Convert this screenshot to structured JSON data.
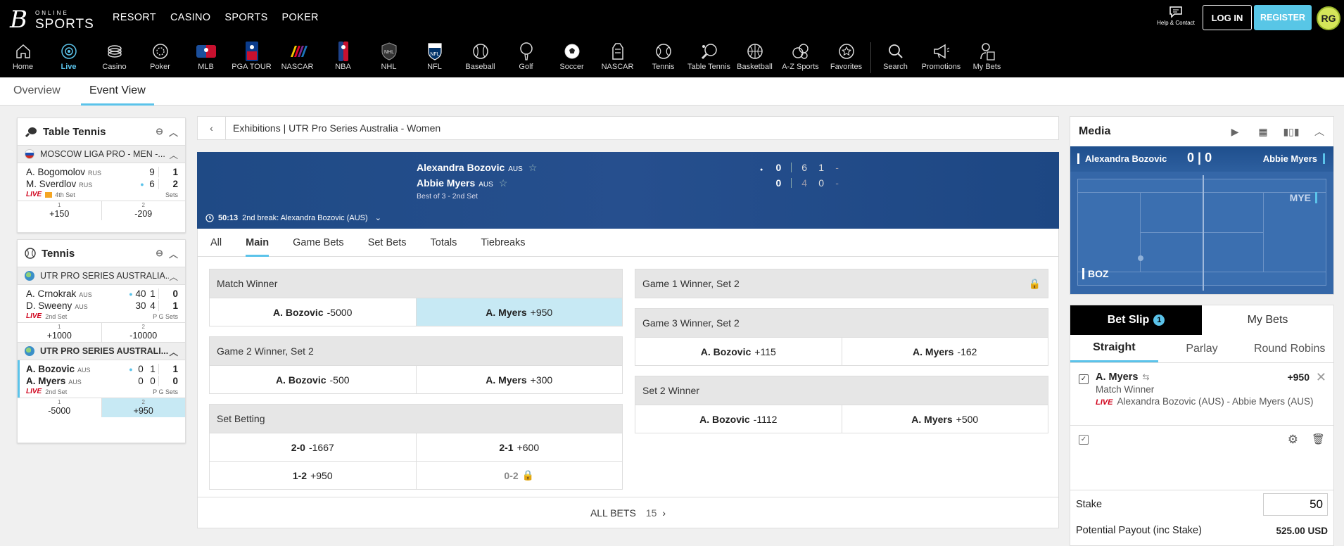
{
  "brand": {
    "online": "ONLINE",
    "sports": "SPORTS"
  },
  "topnav": [
    "RESORT",
    "CASINO",
    "SPORTS",
    "POKER"
  ],
  "header": {
    "help": "Help & Contact",
    "login": "LOG IN",
    "register": "REGISTER",
    "avatar": "RG"
  },
  "iconnav": [
    {
      "label": "Home",
      "icon": "home-icon"
    },
    {
      "label": "Live",
      "icon": "live-icon",
      "active": true
    },
    {
      "label": "Casino",
      "icon": "casino-icon"
    },
    {
      "label": "Poker",
      "icon": "poker-icon"
    },
    {
      "label": "MLB",
      "icon": "mlb-icon"
    },
    {
      "label": "PGA TOUR",
      "icon": "pga-tour-icon"
    },
    {
      "label": "NASCAR",
      "icon": "nascar-stripes-icon"
    },
    {
      "label": "NBA",
      "icon": "nba-icon"
    },
    {
      "label": "NHL",
      "icon": "nhl-icon"
    },
    {
      "label": "NFL",
      "icon": "nfl-icon"
    },
    {
      "label": "Baseball",
      "icon": "baseball-icon"
    },
    {
      "label": "Golf",
      "icon": "golf-icon"
    },
    {
      "label": "Soccer",
      "icon": "soccer-icon"
    },
    {
      "label": "NASCAR",
      "icon": "nascar-car-icon"
    },
    {
      "label": "Tennis",
      "icon": "tennis-icon"
    },
    {
      "label": "Table Tennis",
      "icon": "table-tennis-icon"
    },
    {
      "label": "Basketball",
      "icon": "basketball-icon"
    },
    {
      "label": "A-Z Sports",
      "icon": "a-z-sports-icon"
    },
    {
      "label": "Favorites",
      "icon": "favorites-icon"
    },
    {
      "label": "Search",
      "icon": "search-icon"
    },
    {
      "label": "Promotions",
      "icon": "promotions-icon"
    },
    {
      "label": "My Bets",
      "icon": "my-bets-icon"
    }
  ],
  "subtabs": {
    "overview": "Overview",
    "event_view": "Event View"
  },
  "sidebar": {
    "table_tennis": {
      "title": "Table Tennis",
      "competition": "MOSCOW LIGA PRO - MEN -...",
      "match": {
        "p1": {
          "name": "A. Bogomolov",
          "cc": "RUS",
          "score": "9",
          "sets": "1"
        },
        "p2": {
          "name": "M. Sverdlov",
          "cc": "RUS",
          "score": "6",
          "sets": "2"
        },
        "live": "LIVE",
        "status": "4th Set",
        "cols": "Sets",
        "odds": [
          {
            "n": "1",
            "v": "+150"
          },
          {
            "n": "2",
            "v": "-209"
          }
        ]
      }
    },
    "tennis": {
      "title": "Tennis",
      "competition1": "UTR PRO SERIES AUSTRALIA...",
      "match1": {
        "p1": {
          "name": "A. Crnokrak",
          "cc": "AUS",
          "p": "40",
          "g": "1",
          "sets": "0"
        },
        "p2": {
          "name": "D. Sweeny",
          "cc": "AUS",
          "p": "30",
          "g": "4",
          "sets": "1"
        },
        "live": "LIVE",
        "status": "2nd Set",
        "cols": "P  G  Sets",
        "odds": [
          {
            "n": "1",
            "v": "+1000"
          },
          {
            "n": "2",
            "v": "-10000"
          }
        ]
      },
      "competition2": "UTR PRO SERIES AUSTRALI...",
      "match2": {
        "p1": {
          "name": "A. Bozovic",
          "cc": "AUS",
          "p": "0",
          "g": "1",
          "sets": "1"
        },
        "p2": {
          "name": "A. Myers",
          "cc": "AUS",
          "p": "0",
          "g": "0",
          "sets": "0"
        },
        "live": "LIVE",
        "status": "2nd Set",
        "cols": "P  G  Sets",
        "odds": [
          {
            "n": "1",
            "v": "-5000"
          },
          {
            "n": "2",
            "v": "+950"
          }
        ]
      }
    }
  },
  "breadcrumb": "Exhibitions | UTR Pro Series Australia - Women",
  "scoreboard": {
    "p1": {
      "name": "Alexandra Bozovic",
      "cc": "AUS",
      "points": "0",
      "set1": "6",
      "set2": "1",
      "set3": "-"
    },
    "p2": {
      "name": "Abbie Myers",
      "cc": "AUS",
      "points": "0",
      "set1": "4",
      "set2": "0",
      "set3": "-"
    },
    "info": "Best of 3 - 2nd Set",
    "clock": "50:13",
    "status": "2nd break: Alexandra Bozovic (AUS)"
  },
  "market_tabs": [
    "All",
    "Main",
    "Game Bets",
    "Set Bets",
    "Totals",
    "Tiebreaks"
  ],
  "markets_left": [
    {
      "title": "Match Winner",
      "rows": [
        [
          {
            "sel": "A. Bozovic",
            "odds": "-5000"
          },
          {
            "sel": "A. Myers",
            "odds": "+950",
            "selected": true
          }
        ]
      ]
    },
    {
      "title": "Game 2 Winner, Set 2",
      "rows": [
        [
          {
            "sel": "A. Bozovic",
            "odds": "-500"
          },
          {
            "sel": "A. Myers",
            "odds": "+300"
          }
        ]
      ]
    },
    {
      "title": "Set Betting",
      "rows": [
        [
          {
            "sel": "2-0",
            "odds": "-1667"
          },
          {
            "sel": "2-1",
            "odds": "+600"
          }
        ],
        [
          {
            "sel": "1-2",
            "odds": "+950"
          },
          {
            "sel": "0-2",
            "odds": "",
            "locked": true
          }
        ]
      ]
    }
  ],
  "markets_right": [
    {
      "title": "Game 1 Winner, Set 2",
      "locked": true,
      "rows": []
    },
    {
      "title": "Game 3 Winner, Set 2",
      "rows": [
        [
          {
            "sel": "A. Bozovic",
            "odds": "+115"
          },
          {
            "sel": "A. Myers",
            "odds": "-162"
          }
        ]
      ]
    },
    {
      "title": "Set 2 Winner",
      "rows": [
        [
          {
            "sel": "A. Bozovic",
            "odds": "-1112"
          },
          {
            "sel": "A. Myers",
            "odds": "+500"
          }
        ]
      ]
    }
  ],
  "all_bets": {
    "label": "ALL BETS",
    "count": "15"
  },
  "media": {
    "title": "Media",
    "p1": "Alexandra Bozovic",
    "p2": "Abbie Myers",
    "score1": "0",
    "score2": "0",
    "abbr_top": "MYE",
    "abbr_bottom": "BOZ"
  },
  "betslip": {
    "tab_slip": "Bet Slip",
    "count": "1",
    "tab_mybets": "My Bets",
    "types": [
      "Straight",
      "Parlay",
      "Round Robins"
    ],
    "bet": {
      "selection": "A. Myers",
      "odds": "+950",
      "market": "Match Winner",
      "live": "LIVE",
      "event": "Alexandra Bozovic (AUS) - Abbie Myers (AUS)"
    },
    "stake_label": "Stake",
    "stake_value": "50",
    "payout_label": "Potential Payout (inc Stake)",
    "payout_value": "525.00 USD"
  },
  "colors": {
    "accent": "#5bc3ea",
    "live": "#d0021b",
    "scoreboard": "#1f4a85"
  }
}
